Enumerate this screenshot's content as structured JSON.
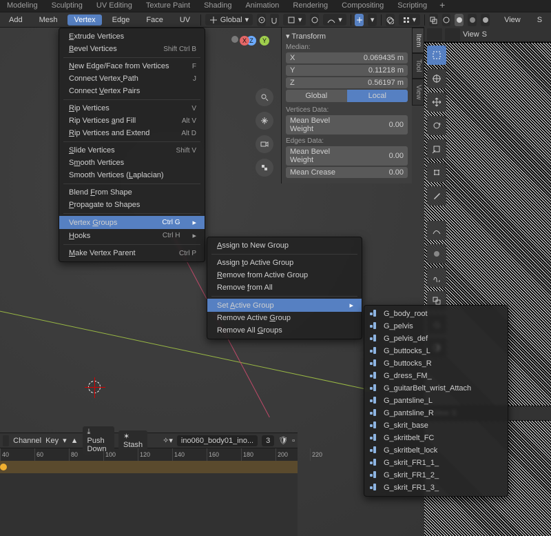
{
  "workspace_tabs": [
    "Modeling",
    "Sculpting",
    "UV Editing",
    "Texture Paint",
    "Shading",
    "Animation",
    "Rendering",
    "Compositing",
    "Scripting"
  ],
  "header": {
    "add": "Add",
    "mesh": "Mesh",
    "vertex": "Vertex",
    "edge": "Edge",
    "face": "Face",
    "uv": "UV",
    "orientation": "Global",
    "view": "View",
    "s": "S"
  },
  "vertex_menu": [
    {
      "label": "Extrude Vertices",
      "u": 0
    },
    {
      "label": "Bevel Vertices",
      "u": 0,
      "sc": "Shift Ctrl B"
    },
    {
      "sep": true
    },
    {
      "label": "New Edge/Face from Vertices",
      "u": 0,
      "sc": "F"
    },
    {
      "label": "Connect Vertex Path",
      "u": 14,
      "sc": "J"
    },
    {
      "label": "Connect Vertex Pairs",
      "u": 8
    },
    {
      "sep": true
    },
    {
      "label": "Rip Vertices",
      "u": 0,
      "sc": "V"
    },
    {
      "label": "Rip Vertices and Fill",
      "u": 13,
      "sc": "Alt V"
    },
    {
      "label": "Rip Vertices and Extend",
      "u": 0,
      "sc": "Alt D"
    },
    {
      "sep": true
    },
    {
      "label": "Slide Vertices",
      "u": 0,
      "sc": "Shift V"
    },
    {
      "label": "Smooth Vertices",
      "u": 1
    },
    {
      "label": "Smooth Vertices (Laplacian)",
      "u": 17
    },
    {
      "sep": true
    },
    {
      "label": "Blend From Shape",
      "u": 6
    },
    {
      "label": "Propagate to Shapes",
      "u": 0
    },
    {
      "sep": true
    },
    {
      "label": "Vertex Groups",
      "u": 7,
      "sc": "Ctrl G",
      "sub": true,
      "hi": true
    },
    {
      "label": "Hooks",
      "u": 0,
      "sc": "Ctrl H",
      "sub": true
    },
    {
      "sep": true
    },
    {
      "label": "Make Vertex Parent",
      "u": 0,
      "sc": "Ctrl P"
    }
  ],
  "vg_menu": [
    {
      "label": "Assign to New Group",
      "u": 0
    },
    {
      "sep": true
    },
    {
      "label": "Assign to Active Group",
      "u": 7
    },
    {
      "label": "Remove from Active Group",
      "u": 0
    },
    {
      "label": "Remove from All",
      "u": 7
    },
    {
      "sep": true
    },
    {
      "label": "Set Active Group",
      "u": 4,
      "sub": true,
      "hi": true
    },
    {
      "label": "Remove Active Group",
      "u": 14
    },
    {
      "label": "Remove All Groups",
      "u": 11
    }
  ],
  "groups": [
    "G_body_root",
    "G_pelvis",
    "G_pelvis_def",
    "G_buttocks_L",
    "G_buttocks_R",
    "G_dress_FM_",
    "G_guitarBelt_wrist_Attach",
    "G_pantsline_L",
    "G_pantsline_R",
    "G_skrit_base",
    "G_skritbelt_FC",
    "G_skritbelt_lock",
    "G_skrit_FR1_1_",
    "G_skrit_FR1_2_",
    "G_skrit_FR1_3_"
  ],
  "transform": {
    "title": "Transform",
    "median": "Median:",
    "x": "X",
    "xv": "0.069435 m",
    "y": "Y",
    "yv": "0.11218 m",
    "z": "Z",
    "zv": "0.56197 m",
    "global": "Global",
    "local": "Local",
    "vdata": "Vertices Data:",
    "mbw": "Mean Bevel Weight",
    "mbwv": "0.00",
    "edata": "Edges Data:",
    "mc": "Mean Crease",
    "mcv": "0.00"
  },
  "ntabs": {
    "item": "Item",
    "tool": "Tool",
    "view": "View"
  },
  "dope": {
    "channel": "Channel",
    "key": "Key",
    "push": "Push Down",
    "stash": "Stash",
    "action": "ino060_body01_ino...",
    "num": "3",
    "ticks": [
      "40",
      "60",
      "80",
      "100",
      "120",
      "140",
      "160",
      "180",
      "200",
      "220"
    ]
  },
  "uv": {
    "view": "View",
    "s": "S"
  }
}
